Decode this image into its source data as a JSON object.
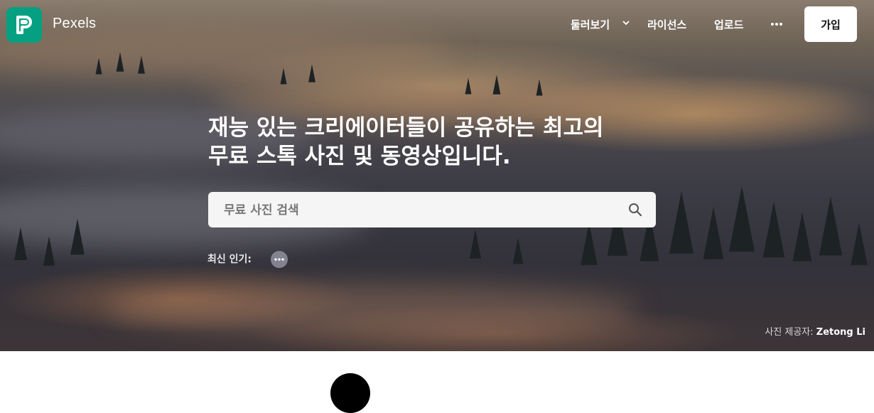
{
  "header": {
    "brand": "Pexels",
    "nav": {
      "browse_label": "둘러보기",
      "license_label": "라이선스",
      "upload_label": "업로드",
      "more_icon": "more-horizontal-icon"
    },
    "join_label": "가입"
  },
  "hero": {
    "headline_line1": "재능 있는 크리에이터들이 공유하는 최고의",
    "headline_line2": "무료 스톡 사진 및 동영상입니다.",
    "search": {
      "placeholder": "무료 사진 검색",
      "value": "",
      "icon": "search-icon"
    },
    "trending_label": "최신 인기:",
    "credit": {
      "prefix": "사진 제공자:",
      "author": "Zetong Li"
    }
  },
  "colors": {
    "brand_green": "#05a081",
    "join_button_bg": "#ffffff",
    "search_bg": "#f5f5f5"
  }
}
